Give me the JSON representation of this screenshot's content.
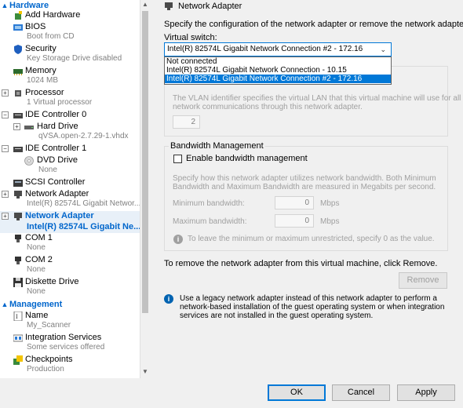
{
  "tree": {
    "hardware_header": "Hardware",
    "management_header": "Management",
    "hardware_items": [
      {
        "name": "add-hardware",
        "title": "Add Hardware",
        "sub": ""
      },
      {
        "name": "bios",
        "title": "BIOS",
        "sub": "Boot from CD"
      },
      {
        "name": "security",
        "title": "Security",
        "sub": "Key Storage Drive disabled"
      },
      {
        "name": "memory",
        "title": "Memory",
        "sub": "1024 MB"
      },
      {
        "name": "processor",
        "title": "Processor",
        "sub": "1 Virtual processor"
      },
      {
        "name": "ide-controller-0",
        "title": "IDE Controller 0",
        "sub": ""
      },
      {
        "name": "hard-drive",
        "title": "Hard Drive",
        "sub": "qVSA.open-2.7.29-1.vhdx"
      },
      {
        "name": "ide-controller-1",
        "title": "IDE Controller 1",
        "sub": ""
      },
      {
        "name": "dvd-drive",
        "title": "DVD Drive",
        "sub": "None"
      },
      {
        "name": "scsi-controller",
        "title": "SCSI Controller",
        "sub": ""
      },
      {
        "name": "network-adapter-1",
        "title": "Network Adapter",
        "sub": "Intel(R) 82574L Gigabit Networ..."
      },
      {
        "name": "network-adapter-2",
        "title": "Network Adapter",
        "sub": "Intel(R) 82574L Gigabit Ne..."
      },
      {
        "name": "com1",
        "title": "COM 1",
        "sub": "None"
      },
      {
        "name": "com2",
        "title": "COM 2",
        "sub": "None"
      },
      {
        "name": "diskette-drive",
        "title": "Diskette Drive",
        "sub": "None"
      }
    ],
    "management_items": [
      {
        "name": "name",
        "title": "Name",
        "sub": "My_Scanner"
      },
      {
        "name": "integration-services",
        "title": "Integration Services",
        "sub": "Some services offered"
      },
      {
        "name": "checkpoints",
        "title": "Checkpoints",
        "sub": "Production"
      }
    ]
  },
  "panel": {
    "title": "Network Adapter",
    "description": "Specify the configuration of the network adapter or remove the network adapter.",
    "virtual_switch_label": "Virtual switch:",
    "virtual_switch_value": "Intel(R) 82574L Gigabit Network Connection #2 - 172.16",
    "virtual_switch_options": [
      "Not connected",
      "Intel(R) 82574L Gigabit Network Connection - 10.15",
      "Intel(R) 82574L Gigabit Network Connection #2 - 172.16"
    ],
    "vlan_text_1": "The VLAN identifier specifies the virtual LAN that this virtual machine will use for all",
    "vlan_text_2": "network communications through this network adapter.",
    "vlan_id": "2",
    "bandwidth_group": "Bandwidth Management",
    "enable_bandwidth": "Enable bandwidth management",
    "bw_text_1": "Specify how this network adapter utilizes network bandwidth. Both Minimum",
    "bw_text_2": "Bandwidth and Maximum Bandwidth are measured in Megabits per second.",
    "min_bw_label": "Minimum bandwidth:",
    "min_bw_value": "0",
    "max_bw_label": "Maximum bandwidth:",
    "max_bw_value": "0",
    "unit": "Mbps",
    "bw_hint": "To leave the minimum or maximum unrestricted, specify 0 as the value.",
    "remove_text": "To remove the network adapter from this virtual machine, click Remove.",
    "remove_button": "Remove",
    "legacy_1": "Use a legacy network adapter instead of this network adapter to perform a",
    "legacy_2": "network-based installation of the guest operating system or when integration",
    "legacy_3": "services are not installed in the guest operating system."
  },
  "buttons": {
    "ok": "OK",
    "cancel": "Cancel",
    "apply": "Apply"
  },
  "colors": {
    "accent": "#0078d7",
    "header_blue": "#0066cc",
    "selected_bg": "#e8f0f8"
  }
}
